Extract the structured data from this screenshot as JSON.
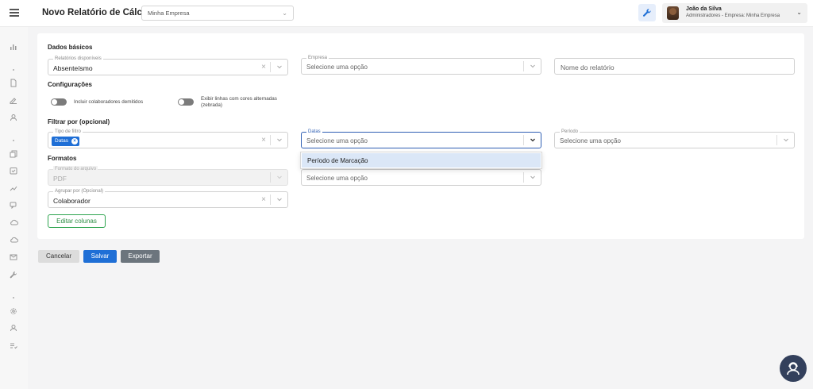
{
  "header": {
    "title": "Novo Relatório de Cálculos",
    "company_select": "Minha Empresa",
    "user_name": "João da Silva",
    "user_role": "Administradores - Empresa: Minha Empresa"
  },
  "form": {
    "basic_section": "Dados básicos",
    "reports_label": "Relatórios disponíveis",
    "reports_value": "Absenteísmo",
    "company_label": "Empresa",
    "company_placeholder": "Selecione uma opção",
    "report_name_placeholder": "Nome do relatório",
    "config_section": "Configurações",
    "toggle_dismissed_label": "Incluir colaboradores demitidos",
    "toggle_zebra_label_1": "Exibir linhas com cores alternadas",
    "toggle_zebra_label_2": "(zebrada)",
    "filter_section": "Filtrar por (opcional)",
    "filter_type_label": "Tipo de filtro",
    "filter_chip": "Datas",
    "dates_label": "Datas",
    "dates_placeholder": "Selecione uma opção",
    "period_label": "Período",
    "period_placeholder": "Selecione uma opção",
    "formats_section": "Formatos",
    "file_format_label": "Formato do arquivo",
    "file_format_value": "PDF",
    "second_format_placeholder": "Selecione uma opção",
    "group_label": "Agrupar por (Opcional)",
    "group_value": "Colaborador",
    "edit_columns": "Editar colunas"
  },
  "dropdown": {
    "options": [
      "Período de Marcação"
    ]
  },
  "actions": {
    "cancel": "Cancelar",
    "save": "Salvar",
    "export": "Exportar"
  },
  "colors": {
    "primary": "#1f6fd6",
    "success": "#2ea44f",
    "secondary": "#6c757d"
  }
}
